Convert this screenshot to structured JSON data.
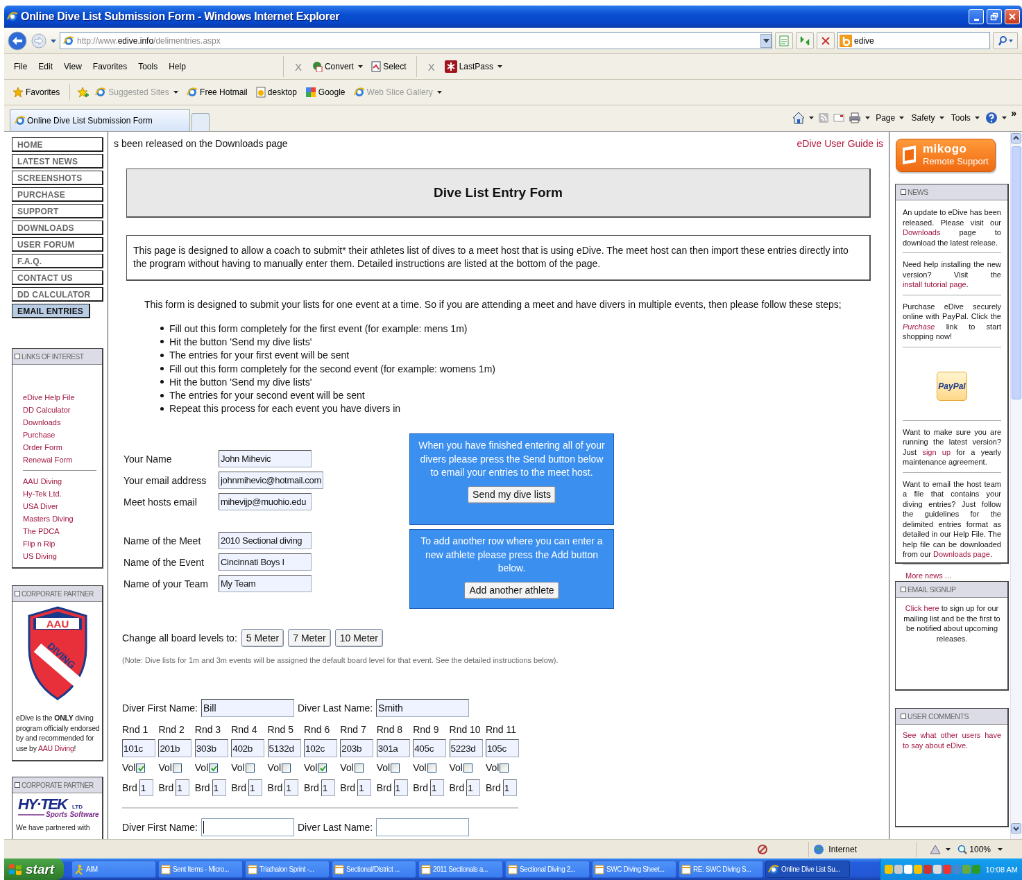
{
  "window": {
    "title": "Online Dive List Submission Form - Windows Internet Explorer"
  },
  "address_bar": {
    "url_start": "http://www.",
    "url_domain": "edive.info",
    "url_end": "/delimentries.aspx"
  },
  "search": {
    "value": "edive"
  },
  "menu": [
    "File",
    "Edit",
    "View",
    "Favorites",
    "Tools",
    "Help"
  ],
  "toolbars": [
    {
      "close": "X",
      "items": [
        {
          "label": "Convert",
          "dropdown": true
        },
        {
          "label": "Select",
          "dropdown": false
        }
      ]
    },
    {
      "close": "X",
      "items": [
        {
          "label": "LastPass",
          "dropdown": true
        }
      ]
    }
  ],
  "favorites_bar": {
    "label": "Favorites",
    "items": [
      {
        "label": "Suggested Sites",
        "dimmed": true,
        "dropdown": true
      },
      {
        "label": "Free Hotmail",
        "dimmed": false,
        "dropdown": false
      },
      {
        "label": "desktop",
        "dimmed": false,
        "dropdown": false
      },
      {
        "label": "Google",
        "dimmed": false,
        "dropdown": false
      },
      {
        "label": "Web Slice Gallery",
        "dimmed": true,
        "dropdown": true
      }
    ]
  },
  "tabs": [
    {
      "label": "Online Dive List Submission Form",
      "selected": true
    }
  ],
  "command_bar": {
    "menus": [
      "Page",
      "Safety",
      "Tools"
    ],
    "more": "»"
  },
  "side_nav": [
    {
      "label": "HOME",
      "selected": false
    },
    {
      "label": "LATEST NEWS",
      "selected": false
    },
    {
      "label": "SCREENSHOTS",
      "selected": false
    },
    {
      "label": "PURCHASE",
      "selected": false
    },
    {
      "label": "SUPPORT",
      "selected": false
    },
    {
      "label": "DOWNLOADS",
      "selected": false
    },
    {
      "label": "USER FORUM",
      "selected": false
    },
    {
      "label": "F.A.Q.",
      "selected": false
    },
    {
      "label": "CONTACT US",
      "selected": false
    },
    {
      "label": "DD CALCULATOR",
      "selected": false
    },
    {
      "label": "EMAIL ENTRIES",
      "selected": true
    }
  ],
  "links_panel": {
    "title": "LINKS OF INTEREST",
    "groups": [
      [
        "eDive Help File",
        "DD Calculator",
        "Downloads",
        "Purchase",
        "Order Form",
        "Renewal Form"
      ],
      [
        "AAU Diving",
        "Hy-Tek Ltd.",
        "USA Diver",
        "Masters Diving",
        "The PDCA",
        "Flip n Rip",
        "US Diving"
      ]
    ]
  },
  "partners": [
    {
      "title": "CORPORATE PARTNER",
      "kind": "aau",
      "logo_words": [
        "AAU",
        "DIVING"
      ],
      "text": [
        {
          "text": "eDive is the **ONLY** diving program officially endorsed by and recommended for use by ",
          "link": false
        },
        {
          "text": "AAU Diving",
          "link": true
        },
        {
          "text": "!",
          "link": false
        }
      ]
    },
    {
      "title": "CORPORATE PARTNER",
      "kind": "hytek",
      "logo_words": [
        "HY·TEK",
        "LTD",
        "Sports Software"
      ],
      "text": [
        {
          "text": "We have partnered with",
          "link": false
        }
      ]
    }
  ],
  "ticker": {
    "left": "s been released on the Downloads page",
    "right": "eDive User Guide is"
  },
  "heading": "Dive List Entry Form",
  "intro": "This page is designed to allow a coach to submit* their athletes list of dives to a meet host that is using eDive. The meet host can then import these entries directly into the program without having to manually enter them. Detailed instructions are listed at the bottom of the page.",
  "steps_intro": "This form is designed to submit your lists for one event at a time. So if you are attending a meet and have divers in multiple events, then please follow these steps;",
  "steps": [
    "Fill out this form completely for the first event (for example: mens 1m)",
    "Hit the button 'Send my dive lists'",
    "The entries for your first event will be sent",
    "Fill out this form completely for the second event (for example: womens 1m)",
    "Hit the button 'Send my dive lists'",
    "The entries for your second event will be sent",
    "Repeat this process for each event you have divers in"
  ],
  "field_groups": [
    [
      {
        "label": "Your Name",
        "value": "John Mihevic"
      },
      {
        "label": "Your email address",
        "value": "johnmihevic@hotmail.com"
      },
      {
        "label": "Meet hosts email",
        "value": "mihevijp@muohio.edu"
      }
    ],
    [
      {
        "label": "Name of the Meet",
        "value": "2010 Sectional diving"
      },
      {
        "label": "Name of the Event",
        "value": "Cincinnati Boys I"
      },
      {
        "label": "Name of your Team",
        "value": "My Team"
      }
    ]
  ],
  "action_boxes": [
    {
      "message": "When you have finished entering all of your divers please press the Send button below to email your entries to the meet host.",
      "button": "Send my dive lists"
    },
    {
      "message": "To add another row where you can enter a new athlete please press the Add button below.",
      "button": "Add another athlete"
    }
  ],
  "board_levels": {
    "label": "Change all board levels to:",
    "buttons": [
      "5 Meter",
      "7 Meter",
      "10 Meter"
    ]
  },
  "note": "(Note: Dive lists for 1m and 3m events will be assigned the default board level for that event. See the detailed instructions below).",
  "divers": [
    {
      "first_label": "Diver First Name:",
      "first_value": "Bill",
      "last_label": "Diver Last Name:",
      "last_value": "Smith",
      "focused": false,
      "rounds": [
        {
          "label": "Rnd 1",
          "dive": "101c",
          "vol_label": "Vol",
          "volunteer": true,
          "brd_label": "Brd",
          "board": "1"
        },
        {
          "label": "Rnd 2",
          "dive": "201b",
          "vol_label": "Vol",
          "volunteer": false,
          "brd_label": "Brd",
          "board": "1"
        },
        {
          "label": "Rnd 3",
          "dive": "303b",
          "vol_label": "Vol",
          "volunteer": true,
          "brd_label": "Brd",
          "board": "1"
        },
        {
          "label": "Rnd 4",
          "dive": "402b",
          "vol_label": "Vol",
          "volunteer": false,
          "brd_label": "Brd",
          "board": "1"
        },
        {
          "label": "Rnd 5",
          "dive": "5132d",
          "vol_label": "Vol",
          "volunteer": false,
          "brd_label": "Brd",
          "board": "1"
        },
        {
          "label": "Rnd 6",
          "dive": "102c",
          "vol_label": "Vol",
          "volunteer": true,
          "brd_label": "Brd",
          "board": "1"
        },
        {
          "label": "Rnd 7",
          "dive": "203b",
          "vol_label": "Vol",
          "volunteer": false,
          "brd_label": "Brd",
          "board": "1"
        },
        {
          "label": "Rnd 8",
          "dive": "301a",
          "vol_label": "Vol",
          "volunteer": false,
          "brd_label": "Brd",
          "board": "1"
        },
        {
          "label": "Rnd 9",
          "dive": "405c",
          "vol_label": "Vol",
          "volunteer": false,
          "brd_label": "Brd",
          "board": "1"
        },
        {
          "label": "Rnd 10",
          "dive": "5223d",
          "vol_label": "Vol",
          "volunteer": false,
          "brd_label": "Brd",
          "board": "1"
        },
        {
          "label": "Rnd 11",
          "dive": "105c",
          "vol_label": "Vol",
          "volunteer": false,
          "brd_label": "Brd",
          "board": "1"
        }
      ]
    },
    {
      "first_label": "Diver First Name:",
      "last_label": "Diver Last Name:",
      "focused": true
    }
  ],
  "mikogo": {
    "words": [
      "mikogo",
      "Remote Support"
    ]
  },
  "news_panel": {
    "title": "NEWS",
    "items": [
      {
        "kind": "text",
        "segments": [
          {
            "text": "An update to eDive has been released. Please visit our ",
            "link": false
          },
          {
            "text": "Downloads",
            "link": true
          },
          {
            "text": " page to download the latest release.",
            "link": false
          }
        ]
      },
      {
        "kind": "text",
        "segments": [
          {
            "text": "Need help installing the new version? Visit the ",
            "link": false
          },
          {
            "text": "install tutorial page",
            "link": true
          },
          {
            "text": ".",
            "link": false
          }
        ]
      },
      {
        "kind": "text",
        "segments": [
          {
            "text": "Purchase eDive securely online with PayPal. Click the ",
            "link": false
          },
          {
            "text": "*Purchase*",
            "link": true
          },
          {
            "text": " link to start shopping now!",
            "link": false
          }
        ]
      },
      {
        "kind": "badge",
        "label": "PayPal"
      },
      {
        "kind": "text",
        "segments": [
          {
            "text": "Want to make sure you are running the latest version? Just ",
            "link": false
          },
          {
            "text": "sign up",
            "link": true
          },
          {
            "text": " for a yearly maintenance agreement.",
            "link": false
          }
        ]
      },
      {
        "kind": "text",
        "segments": [
          {
            "text": "Want to email the host team a file that contains your diving entries? Just follow the guidelines for the delimited entries format as detailed in our Help File. The help file can be downloaded from our ",
            "link": false
          },
          {
            "text": "Downloads page",
            "link": true
          },
          {
            "text": ".",
            "link": false
          }
        ]
      }
    ],
    "more": "More news ..."
  },
  "email_signup": {
    "title": "EMAIL SIGNUP",
    "segments": [
      {
        "text": "Click here",
        "link": true
      },
      {
        "text": " to sign up for our mailing list and be the first to be notified about upcoming releases.",
        "link": false
      }
    ]
  },
  "user_comments": {
    "title": "USER COMMENTS",
    "segments": [
      {
        "text": "See what other users have to say about eDive.",
        "link": true
      }
    ]
  },
  "status_bar": {
    "zone": "Internet",
    "zoom": "100%"
  },
  "taskbar": {
    "start": "start",
    "items": [
      {
        "label": "AIM",
        "selected": false
      },
      {
        "label": "Sent Items - Micro...",
        "selected": false
      },
      {
        "label": "Triathalon Sprint -...",
        "selected": false
      },
      {
        "label": "Sectional/District ...",
        "selected": false
      },
      {
        "label": "2011 Sectionals a...",
        "selected": false
      },
      {
        "label": "Sectional Diving 2...",
        "selected": false
      },
      {
        "label": "SWC Diving Sheet...",
        "selected": false
      },
      {
        "label": "RE: SWC Diving S...",
        "selected": false
      },
      {
        "label": "Online Dive List Su...",
        "selected": true
      }
    ],
    "clock": "10:08 AM"
  }
}
